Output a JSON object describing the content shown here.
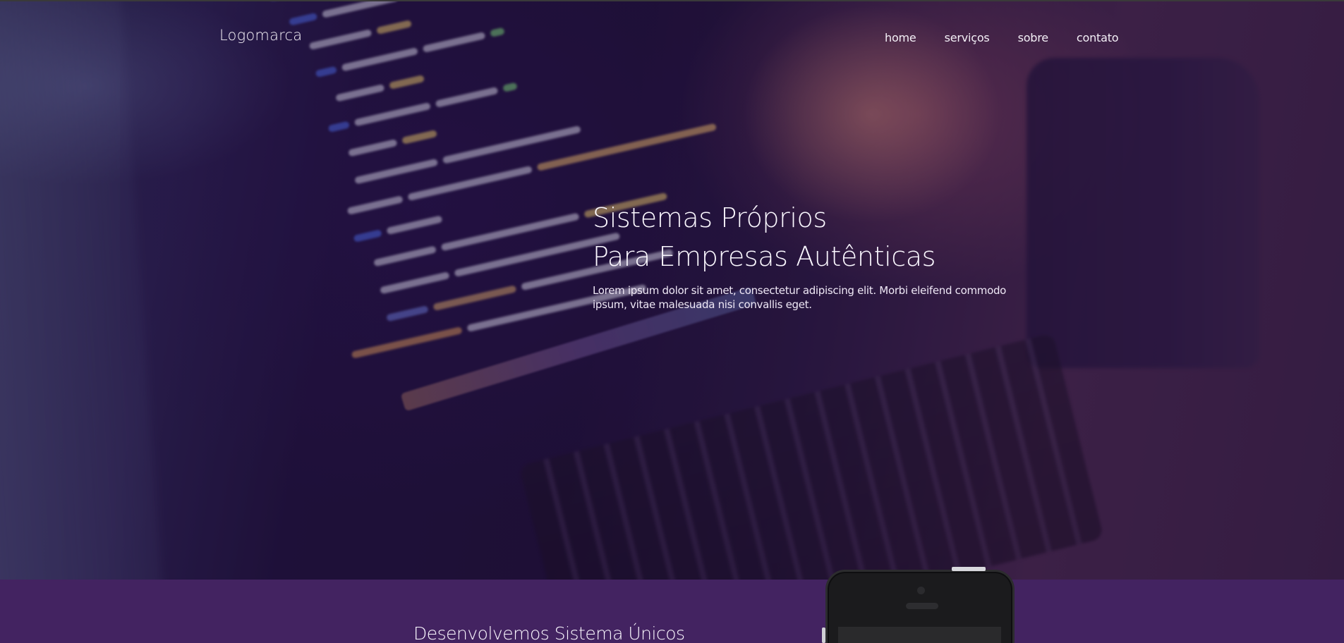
{
  "nav": {
    "logo": "Logomarca",
    "items": [
      {
        "label": "home"
      },
      {
        "label": "serviços"
      },
      {
        "label": "sobre"
      },
      {
        "label": "contato"
      }
    ]
  },
  "hero": {
    "title_line1": "Sistemas Próprios",
    "title_line2": "Para Empresas Autênticas",
    "description": "Lorem ipsum dolor sit amet, consectetur adipiscing elit. Morbi eleifend commodo ipsum, vitae malesuada nisi convallis eget."
  },
  "section2": {
    "title": "Desenvolvemos Sistema Únicos"
  },
  "colors": {
    "section_bg": "#432361",
    "hero_tint": "#230f3c",
    "text": "#ffffff"
  }
}
